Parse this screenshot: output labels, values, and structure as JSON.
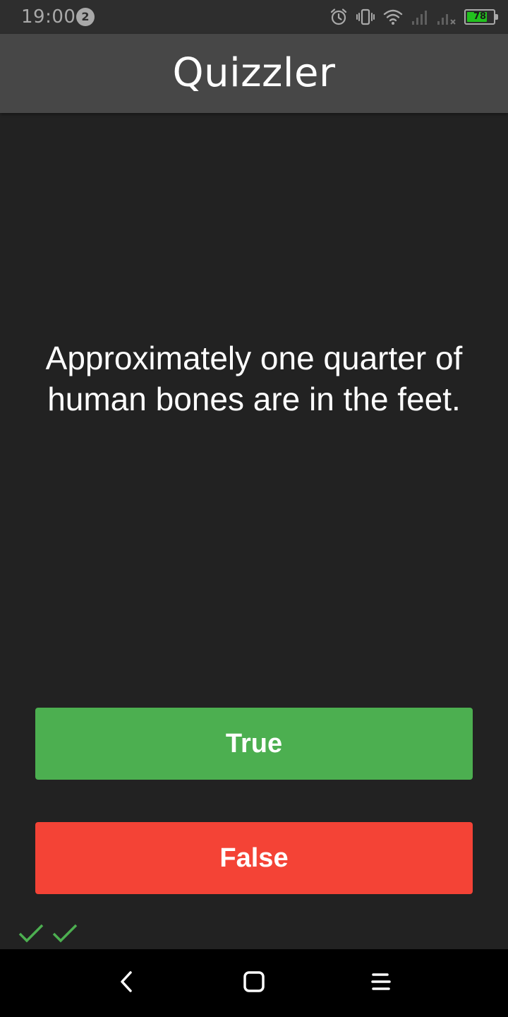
{
  "status_bar": {
    "time": "19:00",
    "notification_count": "2",
    "battery_level": "78",
    "icons": [
      "alarm-icon",
      "vibrate-icon",
      "wifi-icon",
      "signal-icon",
      "signal-no-service-icon",
      "battery-charging-icon"
    ],
    "battery_color": "#22c11e"
  },
  "app_bar": {
    "title": "Quizzler",
    "background": "#474747"
  },
  "quiz": {
    "question": "Approximately one quarter of human bones are in the feet.",
    "true_label": "True",
    "false_label": "False",
    "true_color": "#4caf50",
    "false_color": "#f44336"
  },
  "score_keeper": {
    "marks": [
      "correct",
      "correct"
    ],
    "correct_icon": "check-icon",
    "correct_color": "#4caf50"
  },
  "nav_bar": {
    "buttons": [
      "back-icon",
      "home-icon",
      "menu-icon"
    ]
  }
}
